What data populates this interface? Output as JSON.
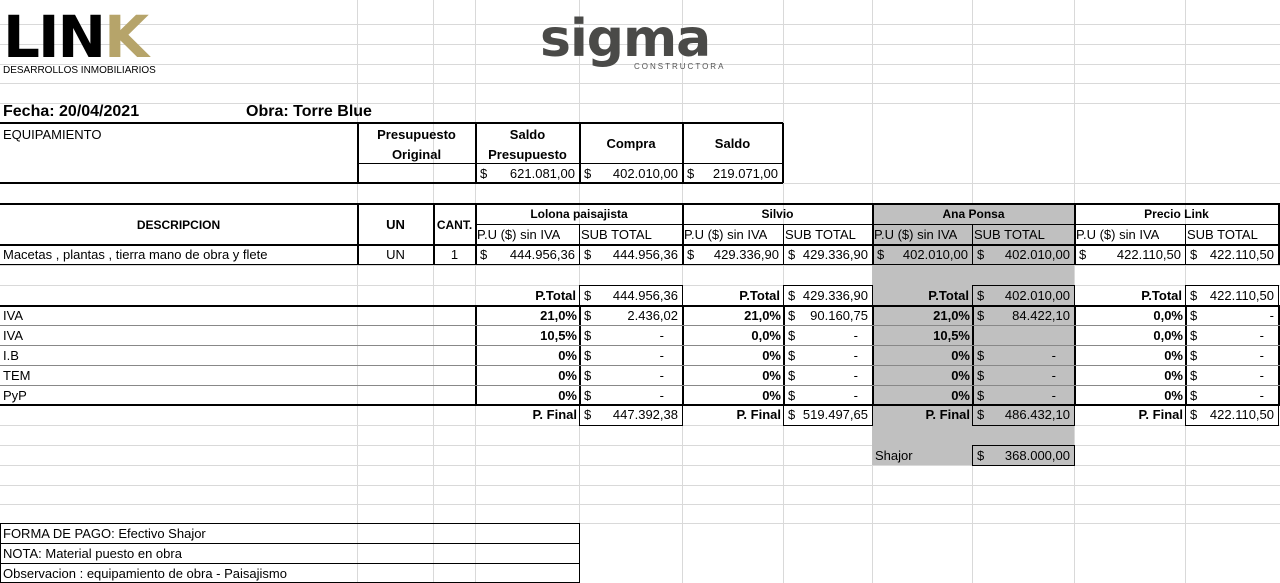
{
  "logos": {
    "link_word": "LIN",
    "link_k": "K",
    "link_sub": "DESARROLLOS INMOBILIARIOS",
    "sigma_word": "sigma",
    "sigma_sub": "CONSTRUCTORA"
  },
  "header": {
    "fecha": "Fecha: 20/04/2021",
    "obra": "Obra: Torre Blue"
  },
  "budget": {
    "section": "EQUIPAMIENTO",
    "h_presupuesto_1": "Presupuesto",
    "h_presupuesto_2": "Original",
    "h_saldo_pres_1": "Saldo",
    "h_saldo_pres_2": "Presupuesto",
    "h_compra": "Compra",
    "h_saldo": "Saldo",
    "currency": "$",
    "saldo_presupuesto": "621.081,00",
    "compra": "402.010,00",
    "saldo": "219.071,00"
  },
  "table": {
    "h_descripcion": "DESCRIPCION",
    "h_un": "UN",
    "h_cant": "CANT.",
    "vendors": [
      "Lolona paisajista",
      "Silvio",
      "Ana Ponsa",
      "Precio Link"
    ],
    "h_pu": "P.U ($) sin IVA",
    "h_sub": "SUB TOTAL",
    "item": {
      "desc": "Macetas , plantas , tierra mano de obra y flete",
      "un": "UN",
      "cant": "1",
      "values": [
        [
          "444.956,36",
          "444.956,36"
        ],
        [
          "429.336,90",
          "429.336,90"
        ],
        [
          "402.010,00",
          "402.010,00"
        ],
        [
          "422.110,50",
          "422.110,50"
        ]
      ]
    },
    "ptotal_label": "P.Total",
    "ptotals": [
      "444.956,36",
      "429.336,90",
      "402.010,00",
      "422.110,50"
    ],
    "pfinal_label": "P. Final",
    "pfinals": [
      "447.392,38",
      "519.497,65",
      "486.432,10",
      "422.110,50"
    ],
    "taxes": [
      {
        "label": "IVA",
        "pct": [
          "21,0%",
          "21,0%",
          "21,0%",
          "0,0%"
        ],
        "val": [
          "2.436,02",
          "90.160,75",
          "84.422,10",
          "-"
        ]
      },
      {
        "label": "IVA",
        "pct": [
          "10,5%",
          "0,0%",
          "10,5%",
          "0,0%"
        ],
        "val": [
          "-",
          "-",
          "",
          "-"
        ]
      },
      {
        "label": "I.B",
        "pct": [
          "0%",
          "0%",
          "0%",
          "0%"
        ],
        "val": [
          "-",
          "-",
          "-",
          "-"
        ]
      },
      {
        "label": "TEM",
        "pct": [
          "0%",
          "0%",
          "0%",
          "0%"
        ],
        "val": [
          "-",
          "-",
          "-",
          "-"
        ]
      },
      {
        "label": "PyP",
        "pct": [
          "0%",
          "0%",
          "0%",
          "0%"
        ],
        "val": [
          "-",
          "-",
          "-",
          "-"
        ]
      }
    ],
    "shajor_label": "Shajor",
    "shajor_value": "368.000,00"
  },
  "footer": {
    "forma_pago": "FORMA DE PAGO: Efectivo Shajor",
    "nota": "NOTA: Material puesto en obra",
    "observacion": "Observacion : equipamiento de obra - Paisajismo"
  },
  "colors": {
    "link_k": "#b6a46a",
    "sigma": "#4a4a48",
    "gray_column": "#c0c0c0",
    "gridline": "#d9d9d9"
  }
}
